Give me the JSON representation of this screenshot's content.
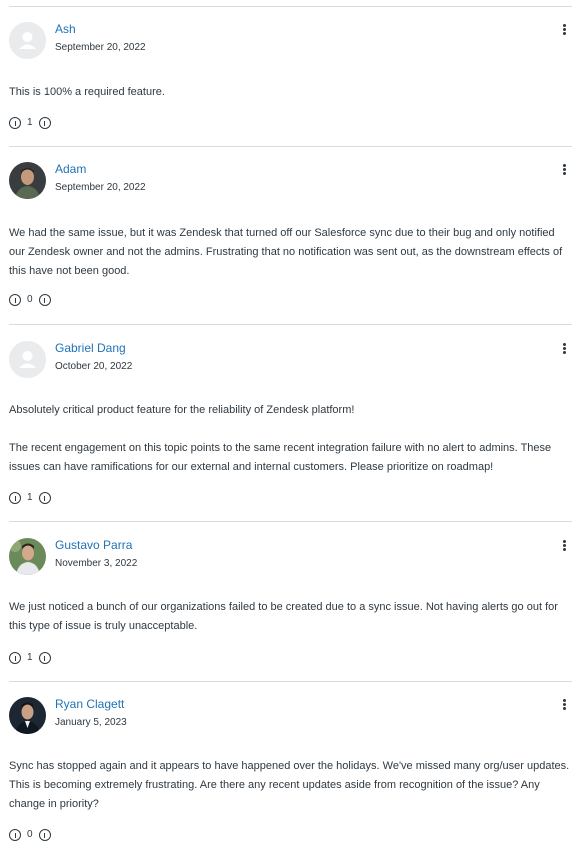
{
  "comments": [
    {
      "author": "Ash",
      "date": "September 20, 2022",
      "avatar": "placeholder",
      "body": "This is 100% a required feature.",
      "votes": "1"
    },
    {
      "author": "Adam",
      "date": "September 20, 2022",
      "avatar": "photo",
      "body": "We had the same issue, but it was Zendesk that turned off our Salesforce sync due to their bug and only notified our Zendesk owner and not the admins. Frustrating that no notification was sent out, as the downstream effects of this have not been good.",
      "votes": "0"
    },
    {
      "author": "Gabriel Dang",
      "date": "October 20, 2022",
      "avatar": "placeholder",
      "body": "Absolutely critical product feature for the reliability of Zendesk platform!\n\nThe recent engagement on this topic points to the same recent integration failure with no alert to admins. These issues can have ramifications for our external and internal customers. Please prioritize on roadmap!",
      "votes": "1"
    },
    {
      "author": "Gustavo Parra",
      "date": "November 3, 2022",
      "avatar": "photo",
      "body": "We just noticed a bunch of our organizations failed to be created due to a sync issue. Not having alerts go out for this type of issue is truly unacceptable.",
      "votes": "1"
    },
    {
      "author": "Ryan Clagett",
      "date": "January 5, 2023",
      "avatar": "photo",
      "body": "Sync has stopped again and it appears to have happened over the holidays. We've missed many org/user updates. This is becoming extremely frustrating. Are there any recent updates aside from recognition of the issue? Any change in priority?",
      "votes": "0"
    }
  ],
  "colors": {
    "author_link": "#1f73b7",
    "text": "#2f3941",
    "divider": "#d8dcde",
    "placeholder_avatar_bg": "#e9ebed",
    "placeholder_avatar_fg": "#ffffff"
  },
  "icons": {
    "menu": "vertical-ellipsis-icon",
    "upvote": "vote-up-icon",
    "downvote": "vote-down-icon",
    "placeholder_avatar": "user-silhouette-icon"
  }
}
